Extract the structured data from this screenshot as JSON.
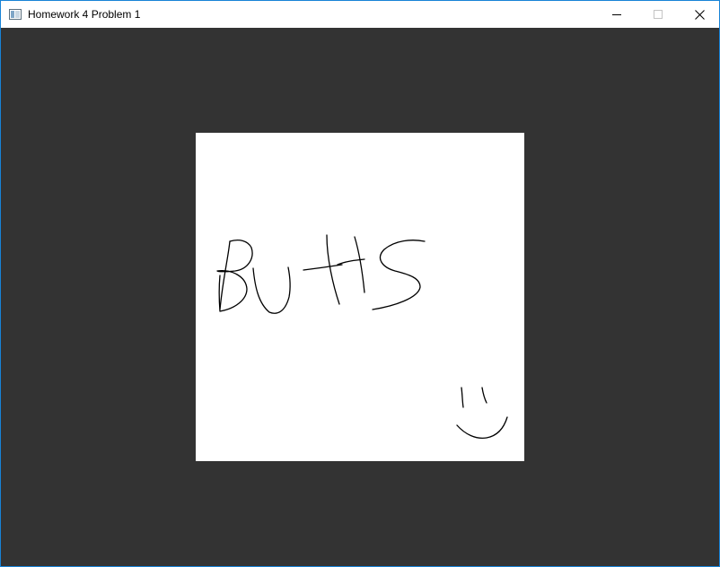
{
  "window": {
    "title": "Homework 4 Problem 1",
    "icon": "app-window-icon",
    "controls": [
      "minimize-icon",
      "maximize-icon",
      "close-icon"
    ]
  },
  "colors": {
    "client_background": "#333333",
    "canvas_background": "#ffffff",
    "ink": "#000000",
    "window_border": "#1883d7"
  }
}
